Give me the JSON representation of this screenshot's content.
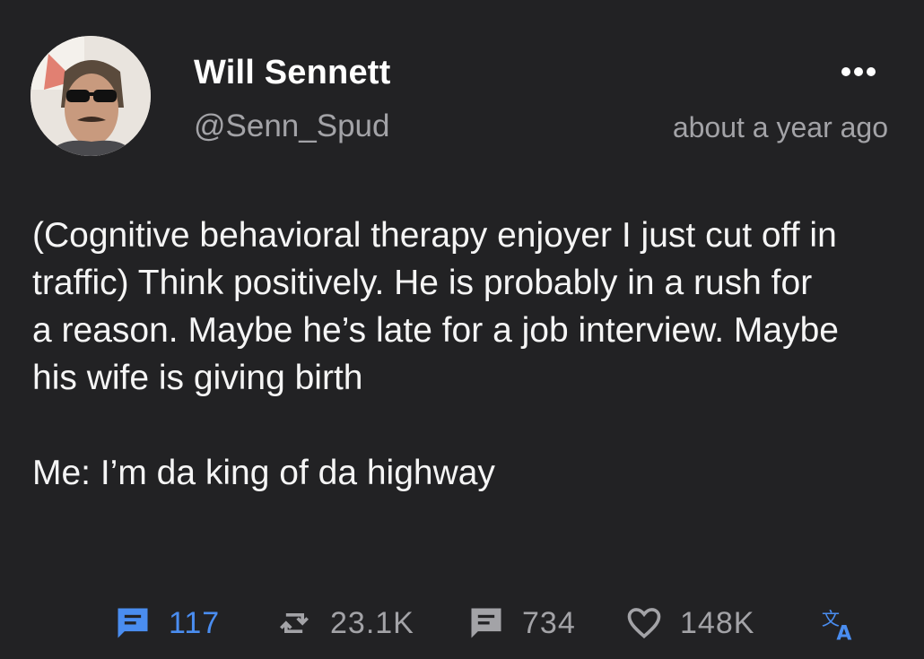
{
  "author": {
    "display_name": "Will Sennett",
    "handle": "@Senn_Spud",
    "avatar_icon": "avatar-photo-sunglasses"
  },
  "post": {
    "timestamp": "about a year ago",
    "paragraphs": [
      "(Cognitive behavioral therapy enjoyer I just cut off in traffic) Think positively. He is probably in a rush for a reason. Maybe he’s late for a job interview. Maybe his wife is giving birth",
      "Me: I’m da king of da highway"
    ]
  },
  "actions": {
    "replies": {
      "icon": "reply-icon",
      "count": "117",
      "color": "#4a8df0"
    },
    "reposts": {
      "icon": "repost-icon",
      "count": "23.1K",
      "color": "#a3a3a7"
    },
    "quotes": {
      "icon": "quote-icon",
      "count": "734",
      "color": "#a3a3a7"
    },
    "likes": {
      "icon": "heart-icon",
      "count": "148K",
      "color": "#a3a3a7"
    },
    "translate": {
      "icon": "translate-icon",
      "color": "#4a8df0"
    }
  },
  "more_menu_icon": "more-dots-icon",
  "colors": {
    "background": "#222224",
    "text": "#f5f5f5",
    "muted": "#a3a3a7",
    "accent": "#4a8df0"
  }
}
